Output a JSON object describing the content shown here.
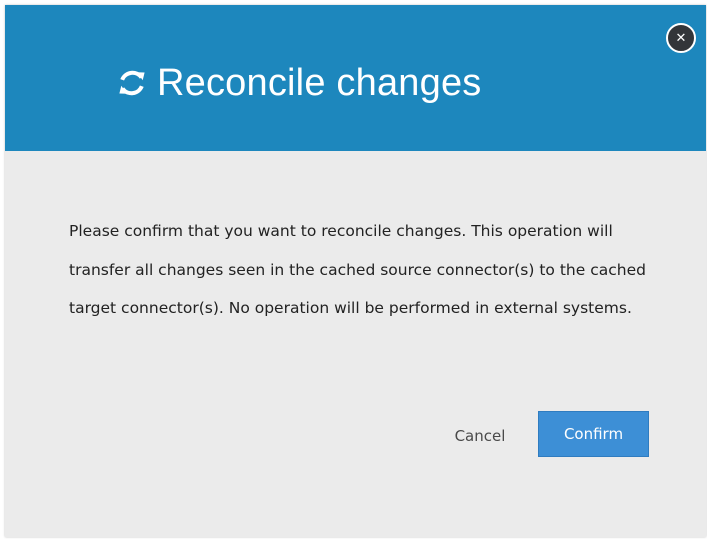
{
  "dialog": {
    "title": "Reconcile changes",
    "title_icon": "sync-icon",
    "close_icon": "close-icon",
    "close_glyph": "✕",
    "message": "Please confirm that you want to reconcile changes. This operation will transfer all changes seen in the cached source connector(s) to the cached target connector(s). No operation will be performed in external systems.",
    "buttons": {
      "cancel_label": "Cancel",
      "confirm_label": "Confirm"
    }
  },
  "colors": {
    "header_background": "#1d87bd",
    "dialog_background": "#ebebeb",
    "confirm_button": "#3d8fd6",
    "close_button": "#333539",
    "body_text": "#222222"
  }
}
